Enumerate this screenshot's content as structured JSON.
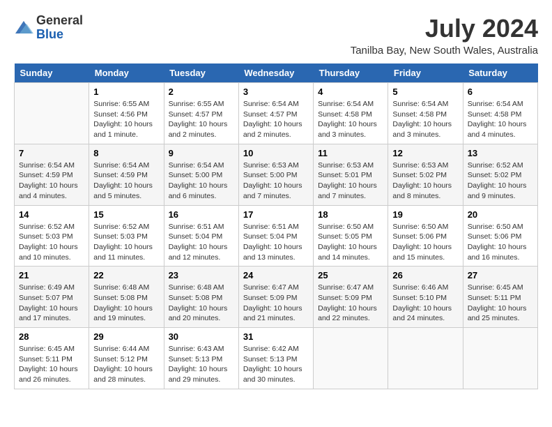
{
  "logo": {
    "general": "General",
    "blue": "Blue"
  },
  "title": "July 2024",
  "location": "Tanilba Bay, New South Wales, Australia",
  "days_of_week": [
    "Sunday",
    "Monday",
    "Tuesday",
    "Wednesday",
    "Thursday",
    "Friday",
    "Saturday"
  ],
  "weeks": [
    [
      {
        "num": "",
        "sunrise": "",
        "sunset": "",
        "daylight": ""
      },
      {
        "num": "1",
        "sunrise": "Sunrise: 6:55 AM",
        "sunset": "Sunset: 4:56 PM",
        "daylight": "Daylight: 10 hours and 1 minute."
      },
      {
        "num": "2",
        "sunrise": "Sunrise: 6:55 AM",
        "sunset": "Sunset: 4:57 PM",
        "daylight": "Daylight: 10 hours and 2 minutes."
      },
      {
        "num": "3",
        "sunrise": "Sunrise: 6:54 AM",
        "sunset": "Sunset: 4:57 PM",
        "daylight": "Daylight: 10 hours and 2 minutes."
      },
      {
        "num": "4",
        "sunrise": "Sunrise: 6:54 AM",
        "sunset": "Sunset: 4:58 PM",
        "daylight": "Daylight: 10 hours and 3 minutes."
      },
      {
        "num": "5",
        "sunrise": "Sunrise: 6:54 AM",
        "sunset": "Sunset: 4:58 PM",
        "daylight": "Daylight: 10 hours and 3 minutes."
      },
      {
        "num": "6",
        "sunrise": "Sunrise: 6:54 AM",
        "sunset": "Sunset: 4:58 PM",
        "daylight": "Daylight: 10 hours and 4 minutes."
      }
    ],
    [
      {
        "num": "7",
        "sunrise": "Sunrise: 6:54 AM",
        "sunset": "Sunset: 4:59 PM",
        "daylight": "Daylight: 10 hours and 4 minutes."
      },
      {
        "num": "8",
        "sunrise": "Sunrise: 6:54 AM",
        "sunset": "Sunset: 4:59 PM",
        "daylight": "Daylight: 10 hours and 5 minutes."
      },
      {
        "num": "9",
        "sunrise": "Sunrise: 6:54 AM",
        "sunset": "Sunset: 5:00 PM",
        "daylight": "Daylight: 10 hours and 6 minutes."
      },
      {
        "num": "10",
        "sunrise": "Sunrise: 6:53 AM",
        "sunset": "Sunset: 5:00 PM",
        "daylight": "Daylight: 10 hours and 7 minutes."
      },
      {
        "num": "11",
        "sunrise": "Sunrise: 6:53 AM",
        "sunset": "Sunset: 5:01 PM",
        "daylight": "Daylight: 10 hours and 7 minutes."
      },
      {
        "num": "12",
        "sunrise": "Sunrise: 6:53 AM",
        "sunset": "Sunset: 5:02 PM",
        "daylight": "Daylight: 10 hours and 8 minutes."
      },
      {
        "num": "13",
        "sunrise": "Sunrise: 6:52 AM",
        "sunset": "Sunset: 5:02 PM",
        "daylight": "Daylight: 10 hours and 9 minutes."
      }
    ],
    [
      {
        "num": "14",
        "sunrise": "Sunrise: 6:52 AM",
        "sunset": "Sunset: 5:03 PM",
        "daylight": "Daylight: 10 hours and 10 minutes."
      },
      {
        "num": "15",
        "sunrise": "Sunrise: 6:52 AM",
        "sunset": "Sunset: 5:03 PM",
        "daylight": "Daylight: 10 hours and 11 minutes."
      },
      {
        "num": "16",
        "sunrise": "Sunrise: 6:51 AM",
        "sunset": "Sunset: 5:04 PM",
        "daylight": "Daylight: 10 hours and 12 minutes."
      },
      {
        "num": "17",
        "sunrise": "Sunrise: 6:51 AM",
        "sunset": "Sunset: 5:04 PM",
        "daylight": "Daylight: 10 hours and 13 minutes."
      },
      {
        "num": "18",
        "sunrise": "Sunrise: 6:50 AM",
        "sunset": "Sunset: 5:05 PM",
        "daylight": "Daylight: 10 hours and 14 minutes."
      },
      {
        "num": "19",
        "sunrise": "Sunrise: 6:50 AM",
        "sunset": "Sunset: 5:06 PM",
        "daylight": "Daylight: 10 hours and 15 minutes."
      },
      {
        "num": "20",
        "sunrise": "Sunrise: 6:50 AM",
        "sunset": "Sunset: 5:06 PM",
        "daylight": "Daylight: 10 hours and 16 minutes."
      }
    ],
    [
      {
        "num": "21",
        "sunrise": "Sunrise: 6:49 AM",
        "sunset": "Sunset: 5:07 PM",
        "daylight": "Daylight: 10 hours and 17 minutes."
      },
      {
        "num": "22",
        "sunrise": "Sunrise: 6:48 AM",
        "sunset": "Sunset: 5:08 PM",
        "daylight": "Daylight: 10 hours and 19 minutes."
      },
      {
        "num": "23",
        "sunrise": "Sunrise: 6:48 AM",
        "sunset": "Sunset: 5:08 PM",
        "daylight": "Daylight: 10 hours and 20 minutes."
      },
      {
        "num": "24",
        "sunrise": "Sunrise: 6:47 AM",
        "sunset": "Sunset: 5:09 PM",
        "daylight": "Daylight: 10 hours and 21 minutes."
      },
      {
        "num": "25",
        "sunrise": "Sunrise: 6:47 AM",
        "sunset": "Sunset: 5:09 PM",
        "daylight": "Daylight: 10 hours and 22 minutes."
      },
      {
        "num": "26",
        "sunrise": "Sunrise: 6:46 AM",
        "sunset": "Sunset: 5:10 PM",
        "daylight": "Daylight: 10 hours and 24 minutes."
      },
      {
        "num": "27",
        "sunrise": "Sunrise: 6:45 AM",
        "sunset": "Sunset: 5:11 PM",
        "daylight": "Daylight: 10 hours and 25 minutes."
      }
    ],
    [
      {
        "num": "28",
        "sunrise": "Sunrise: 6:45 AM",
        "sunset": "Sunset: 5:11 PM",
        "daylight": "Daylight: 10 hours and 26 minutes."
      },
      {
        "num": "29",
        "sunrise": "Sunrise: 6:44 AM",
        "sunset": "Sunset: 5:12 PM",
        "daylight": "Daylight: 10 hours and 28 minutes."
      },
      {
        "num": "30",
        "sunrise": "Sunrise: 6:43 AM",
        "sunset": "Sunset: 5:13 PM",
        "daylight": "Daylight: 10 hours and 29 minutes."
      },
      {
        "num": "31",
        "sunrise": "Sunrise: 6:42 AM",
        "sunset": "Sunset: 5:13 PM",
        "daylight": "Daylight: 10 hours and 30 minutes."
      },
      {
        "num": "",
        "sunrise": "",
        "sunset": "",
        "daylight": ""
      },
      {
        "num": "",
        "sunrise": "",
        "sunset": "",
        "daylight": ""
      },
      {
        "num": "",
        "sunrise": "",
        "sunset": "",
        "daylight": ""
      }
    ]
  ]
}
